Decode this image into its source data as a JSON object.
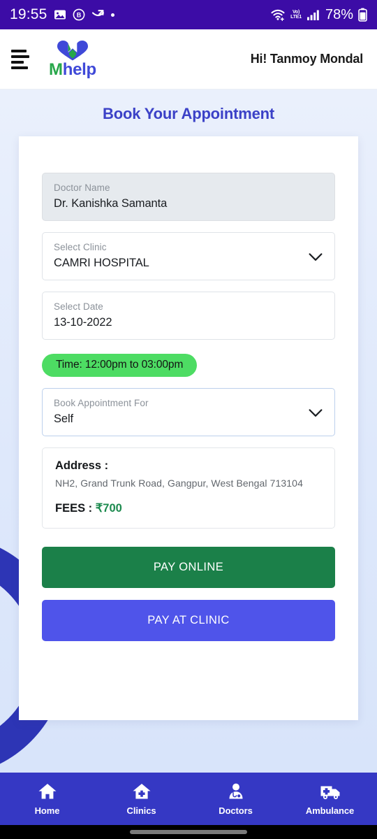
{
  "status_bar": {
    "time": "19:55",
    "battery_percent": "78%",
    "network_label_top": "Vo)",
    "network_label_bottom": "LTE1",
    "icons": [
      "image-icon",
      "circled-b-icon",
      "missed-call-icon",
      "dot-icon",
      "wifi-icon",
      "volte-icon",
      "signal-bars-icon",
      "battery-icon"
    ],
    "bg_color": "#3C0CA6"
  },
  "header": {
    "menu_label": "menu",
    "logo_m": "M",
    "logo_help": "help",
    "greeting": "Hi! Tanmoy Mondal"
  },
  "main": {
    "title": "Book Your Appointment",
    "fields": {
      "doctor": {
        "label": "Doctor Name",
        "value": "Dr. Kanishka Samanta"
      },
      "clinic": {
        "label": "Select Clinic",
        "value": "CAMRI HOSPITAL"
      },
      "date": {
        "label": "Select Date",
        "value": "13-10-2022"
      },
      "appointment_for": {
        "label": "Book Appointment For",
        "value": "Self"
      }
    },
    "time_pill": "Time: 12:00pm to 03:00pm",
    "address": {
      "title": "Address :",
      "line": "NH2, Grand Trunk Road, Gangpur, West Bengal 713104",
      "fees_label": "FEES : ",
      "fees_amount": "₹700"
    },
    "buttons": {
      "pay_online": "PAY ONLINE",
      "pay_at_clinic": "PAY AT CLINIC"
    }
  },
  "bottom_nav": {
    "items": [
      {
        "label": "Home",
        "icon": "home-icon"
      },
      {
        "label": "Clinics",
        "icon": "hospital-icon"
      },
      {
        "label": "Doctors",
        "icon": "doctor-icon"
      },
      {
        "label": "Ambulance",
        "icon": "ambulance-icon"
      }
    ]
  },
  "colors": {
    "status_bar": "#3C0CA6",
    "title": "#3b41c7",
    "time_pill": "#4ddc63",
    "pay_online": "#1b8049",
    "pay_at_clinic": "#4f54ea",
    "bottom_nav": "#3538c4",
    "fees": "#1c8a4e"
  }
}
